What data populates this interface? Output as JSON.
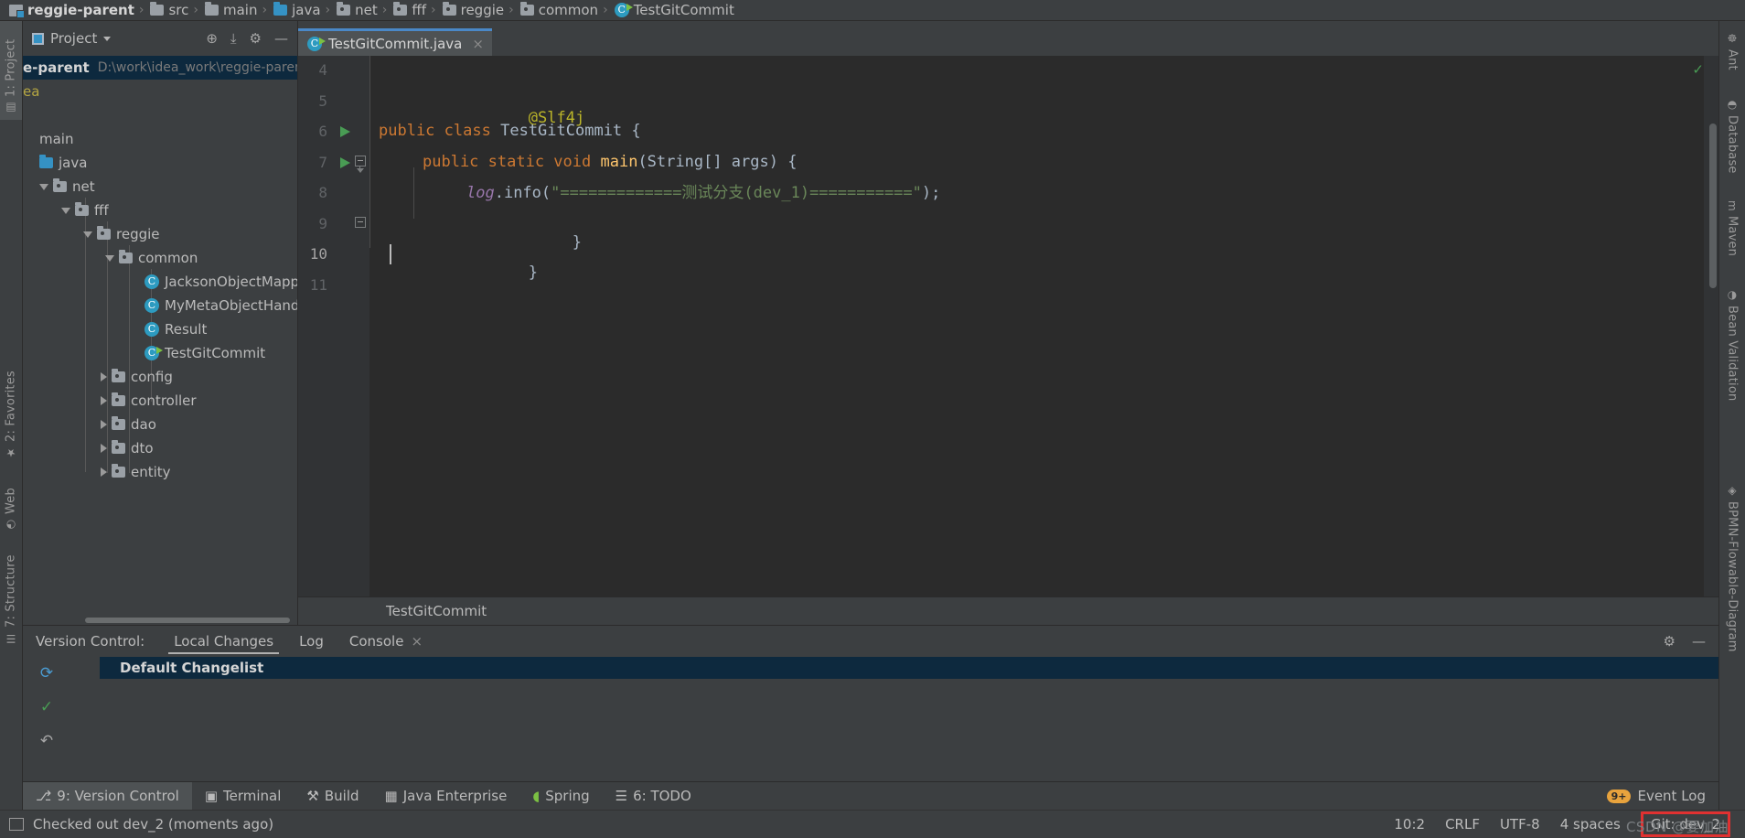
{
  "breadcrumb": [
    {
      "label": "reggie-parent",
      "icon": "module-icon"
    },
    {
      "label": "src",
      "icon": "folder-icon"
    },
    {
      "label": "main",
      "icon": "folder-icon"
    },
    {
      "label": "java",
      "icon": "source-folder-icon"
    },
    {
      "label": "net",
      "icon": "package-icon"
    },
    {
      "label": "fff",
      "icon": "package-icon"
    },
    {
      "label": "reggie",
      "icon": "package-icon"
    },
    {
      "label": "common",
      "icon": "package-icon"
    },
    {
      "label": "TestGitCommit",
      "icon": "java-class-runnable-icon"
    }
  ],
  "breadcrumb_separator": "›",
  "project_panel": {
    "title": "Project",
    "tools": [
      {
        "name": "locate-icon",
        "glyph": "⊕"
      },
      {
        "name": "collapse-all-icon",
        "glyph": "⤓"
      },
      {
        "name": "settings-gear-icon",
        "glyph": "⚙"
      },
      {
        "name": "hide-icon",
        "glyph": "—"
      }
    ],
    "tree": [
      {
        "label": "e-parent",
        "path": "D:\\work\\idea_work\\reggie-parent",
        "indent": 0,
        "arrow": "none",
        "icon": "module-icon",
        "selected": true
      },
      {
        "label": "ea",
        "indent": 1,
        "arrow": "none",
        "icon": "idea-folder-icon",
        "kind": "idea"
      },
      {
        "label": "main",
        "indent": 1,
        "arrow": "none",
        "icon": "none"
      },
      {
        "label": "java",
        "indent": 1,
        "arrow": "none",
        "icon": "source-folder-icon"
      },
      {
        "label": "net",
        "indent": 2,
        "arrow": "down",
        "icon": "package-icon"
      },
      {
        "label": "fff",
        "indent": 3,
        "arrow": "down",
        "icon": "package-icon"
      },
      {
        "label": "reggie",
        "indent": 4,
        "arrow": "down",
        "icon": "package-icon"
      },
      {
        "label": "common",
        "indent": 5,
        "arrow": "down",
        "icon": "package-icon"
      },
      {
        "label": "JacksonObjectMapper",
        "indent": 6,
        "arrow": "none",
        "icon": "java-class-icon"
      },
      {
        "label": "MyMetaObjectHandler",
        "indent": 6,
        "arrow": "none",
        "icon": "java-class-icon"
      },
      {
        "label": "Result",
        "indent": 6,
        "arrow": "none",
        "icon": "java-class-icon"
      },
      {
        "label": "TestGitCommit",
        "indent": 6,
        "arrow": "none",
        "icon": "java-class-runnable-icon"
      },
      {
        "label": "config",
        "indent": 5,
        "arrow": "right",
        "icon": "package-icon"
      },
      {
        "label": "controller",
        "indent": 5,
        "arrow": "right",
        "icon": "package-icon"
      },
      {
        "label": "dao",
        "indent": 5,
        "arrow": "right",
        "icon": "package-icon"
      },
      {
        "label": "dto",
        "indent": 5,
        "arrow": "right",
        "icon": "package-icon"
      },
      {
        "label": "entity",
        "indent": 5,
        "arrow": "right",
        "icon": "package-icon"
      }
    ]
  },
  "editor": {
    "tab": {
      "label": "TestGitCommit.java",
      "close": "×",
      "icon": "java-class-runnable-icon"
    },
    "inspection_status": "✓",
    "lines": [
      {
        "num": "4",
        "run": false,
        "fold": "none"
      },
      {
        "num": "5",
        "run": false,
        "fold": "none"
      },
      {
        "num": "6",
        "run": true,
        "fold": "none"
      },
      {
        "num": "7",
        "run": true,
        "fold": "start"
      },
      {
        "num": "8",
        "run": false,
        "fold": "none"
      },
      {
        "num": "9",
        "run": false,
        "fold": "end"
      },
      {
        "num": "10",
        "run": false,
        "fold": "none",
        "current": true
      },
      {
        "num": "11",
        "run": false,
        "fold": "none"
      }
    ],
    "code": {
      "l5_annotation": "@Slf4j",
      "l6_kw_public": "public",
      "l6_kw_class": "class",
      "l6_name": "TestGitCommit",
      "l6_brace": "{",
      "l7_kw": "public static void",
      "l7_name": "main",
      "l7_sig": "(String[] args) {",
      "l8_field": "log",
      "l8_call": ".info(",
      "l8_string": "\"=============测试分支(dev_1)===========\"",
      "l8_end": ");",
      "l9_brace": "}",
      "l10_brace": "}"
    },
    "footer_breadcrumb": "TestGitCommit"
  },
  "version_control": {
    "label": "Version Control:",
    "tabs": [
      {
        "label": "Local Changes",
        "selected": true,
        "closable": false
      },
      {
        "label": "Log",
        "selected": false,
        "closable": false
      },
      {
        "label": "Console",
        "selected": false,
        "closable": true,
        "close": "×"
      }
    ],
    "header_tools": [
      {
        "name": "settings-gear-icon",
        "glyph": "⚙"
      },
      {
        "name": "hide-icon",
        "glyph": "—"
      }
    ],
    "side_tools": [
      {
        "name": "refresh-icon",
        "glyph": "⟳",
        "color": "#4a9bd1"
      },
      {
        "name": "commit-checkmark-icon",
        "glyph": "✓",
        "color": "#499c54"
      },
      {
        "name": "rollback-icon",
        "glyph": "↶",
        "color": "#a6a6a6"
      }
    ],
    "expand_glyph": "»",
    "changelist": {
      "name": "Default Changelist"
    }
  },
  "left_stripe": [
    {
      "label": "1: Project",
      "selected": true,
      "icon": "project-folder-icon",
      "glyph": "▤"
    },
    {
      "label": "2: Favorites",
      "selected": false,
      "icon": "star-icon",
      "glyph": "★"
    },
    {
      "label": "Web",
      "selected": false,
      "icon": "globe-icon",
      "glyph": "◔"
    },
    {
      "label": "7: Structure",
      "selected": false,
      "icon": "structure-icon",
      "glyph": "☰"
    }
  ],
  "right_stripe": [
    {
      "label": "Ant",
      "icon": "ant-bug-icon",
      "glyph": "☸"
    },
    {
      "label": "Database",
      "icon": "database-icon",
      "glyph": "◓"
    },
    {
      "label": "Maven",
      "icon": "maven-icon",
      "glyph": "m"
    },
    {
      "label": "Bean Validation",
      "icon": "bean-validation-icon",
      "glyph": "◑"
    },
    {
      "label": "BPMN-Flowable-Diagram",
      "icon": "bpmn-icon",
      "glyph": "◈"
    }
  ],
  "bottom_tabs": [
    {
      "label": "9: Version Control",
      "mnemonic": "9",
      "selected": true,
      "icon": "branch-icon",
      "glyph": "⎇"
    },
    {
      "label": "Terminal",
      "selected": false,
      "icon": "terminal-icon",
      "glyph": "▣"
    },
    {
      "label": "Build",
      "selected": false,
      "icon": "hammer-icon",
      "glyph": "⚒"
    },
    {
      "label": "Java Enterprise",
      "selected": false,
      "icon": "java-enterprise-icon",
      "glyph": "▦"
    },
    {
      "label": "Spring",
      "selected": false,
      "icon": "spring-leaf-icon",
      "glyph": "◖"
    },
    {
      "label": "6: TODO",
      "mnemonic": "6",
      "selected": false,
      "icon": "todo-list-icon",
      "glyph": "☰"
    }
  ],
  "event_log": {
    "label": "Event Log",
    "badge": "9+",
    "icon": "event-log-icon"
  },
  "status_bar": {
    "message": "Checked out dev_2 (moments ago)",
    "message_icon": "console-icon",
    "caret_position": "10:2",
    "line_separator": "CRLF",
    "encoding": "UTF-8",
    "indent": "4 spaces",
    "git_branch": "Git: dev_2",
    "git_highlight_color": "#e03131"
  },
  "watermark": {
    "text": "CSDN @要加油"
  }
}
